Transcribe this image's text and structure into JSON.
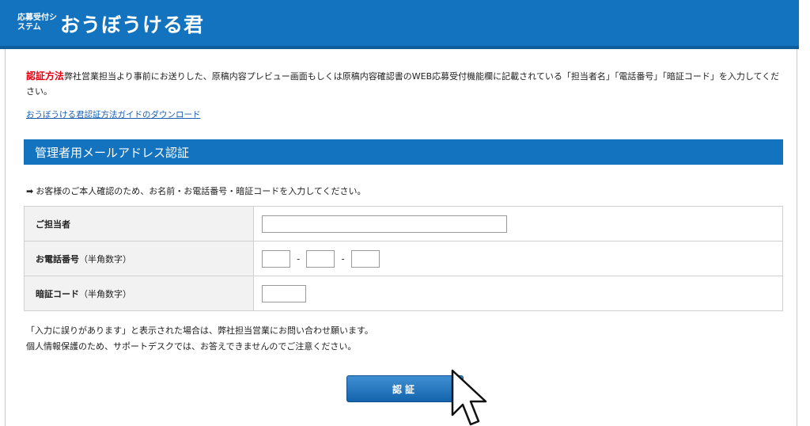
{
  "header": {
    "logo_small": "応募受付システム",
    "logo_main": "おうぼうける君",
    "bg_color": "#1373bf"
  },
  "auth_method": {
    "label": "認証方法",
    "text": "弊社営業担当より事前にお送りした、原稿内容プレビュー画面もしくは原稿内容確認書のWEB応募受付機能欄に記載されている「担当者名」「電話番号」「暗証コード」を入力してください。"
  },
  "guide_link": "おうぼうける君認証方法ガイドのダウンロード",
  "section": {
    "title": "管理者用メールアドレス認証"
  },
  "instruction": {
    "icon": "arrow-right-icon",
    "text": "お客様のご本人確認のため、お名前・お電話番号・暗証コードを入力してください。"
  },
  "form": {
    "person_label": "ご担当者",
    "person_value": "",
    "phone_label": "お電話番号",
    "phone_note": "（半角数字）",
    "phone_parts": [
      "",
      "",
      ""
    ],
    "phone_separator": "-",
    "pin_label": "暗証コード",
    "pin_note": "（半角数字）",
    "pin_value": ""
  },
  "notes": [
    "「入力に誤りがあります」と表示された場合は、弊社担当営業にお問い合わせ願います。",
    "個人情報保護のため、サポートデスクでは、お答えできませんのでご注意ください。"
  ],
  "button": {
    "label": "認証"
  },
  "cursor": "pointer-cursor-icon"
}
